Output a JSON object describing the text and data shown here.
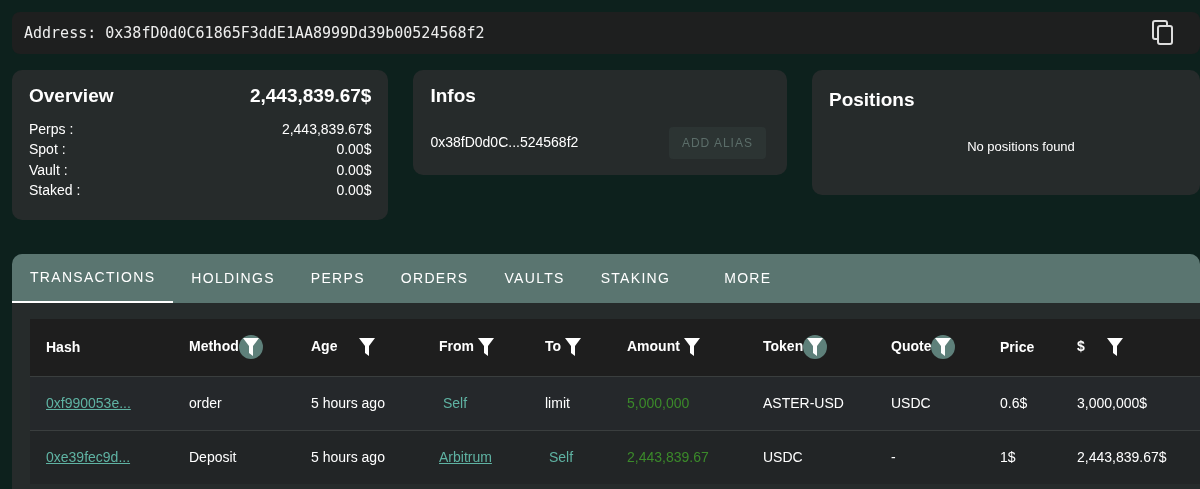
{
  "address_bar": {
    "label": "Address: 0x38fD0d0C61865F3ddE1AA8999Dd39b00524568f2"
  },
  "overview": {
    "title": "Overview",
    "total": "2,443,839.67$",
    "rows": [
      {
        "label": "Perps :",
        "value": "2,443,839.67$"
      },
      {
        "label": "Spot :",
        "value": "0.00$"
      },
      {
        "label": "Vault :",
        "value": "0.00$"
      },
      {
        "label": "Staked :",
        "value": "0.00$"
      }
    ]
  },
  "infos": {
    "title": "Infos",
    "address": "0x38fD0d0C...524568f2",
    "button": {
      "label": "ADD ALIAS",
      "disabled": true
    }
  },
  "positions": {
    "title": "Positions",
    "empty_text": "No positions found"
  },
  "tabs": [
    {
      "label": "TRANSACTIONS",
      "selected": true
    },
    {
      "label": "HOLDINGS",
      "selected": false
    },
    {
      "label": "PERPS",
      "selected": false
    },
    {
      "label": "ORDERS",
      "selected": false
    },
    {
      "label": "VAULTS",
      "selected": false
    },
    {
      "label": "STAKING",
      "selected": false
    },
    {
      "label": "MORE",
      "selected": false
    }
  ],
  "table": {
    "columns": [
      {
        "label": "Hash",
        "kind": "plain"
      },
      {
        "label": "Method",
        "kind": "filter",
        "filtered": true
      },
      {
        "label": "Age",
        "kind": "filter",
        "filtered": false
      },
      {
        "label": "From",
        "kind": "filter",
        "filtered": false
      },
      {
        "label": "To",
        "kind": "filter",
        "filtered": false
      },
      {
        "label": "Amount",
        "kind": "filter",
        "filtered": false
      },
      {
        "label": "Token",
        "kind": "filter",
        "filtered": true
      },
      {
        "label": "Quote",
        "kind": "filter",
        "filtered": true
      },
      {
        "label": "Price",
        "kind": "plain"
      },
      {
        "label": "$",
        "kind": "filter",
        "filtered": false
      }
    ],
    "rows": [
      {
        "cells": [
          {
            "kind": "link",
            "text": "0xf990053e..."
          },
          {
            "kind": "plain",
            "text": "order"
          },
          {
            "kind": "plain",
            "text": "5 hours ago"
          },
          {
            "kind": "tag",
            "text": "Self"
          },
          {
            "kind": "plain",
            "text": "limit"
          },
          {
            "kind": "amount",
            "text": "5,000,000"
          },
          {
            "kind": "plain",
            "text": "ASTER-USD"
          },
          {
            "kind": "plain",
            "text": "USDC"
          },
          {
            "kind": "plain",
            "text": "0.6$"
          },
          {
            "kind": "plain",
            "text": "3,000,000$"
          }
        ]
      },
      {
        "cells": [
          {
            "kind": "link",
            "text": "0xe39fec9d..."
          },
          {
            "kind": "plain",
            "text": "Deposit"
          },
          {
            "kind": "plain",
            "text": "5 hours ago"
          },
          {
            "kind": "link",
            "text": "Arbitrum"
          },
          {
            "kind": "tag",
            "text": "Self"
          },
          {
            "kind": "amount",
            "text": "2,443,839.67"
          },
          {
            "kind": "plain",
            "text": "USDC"
          },
          {
            "kind": "plain",
            "text": "-"
          },
          {
            "kind": "plain",
            "text": "1$"
          },
          {
            "kind": "plain",
            "text": "2,443,839.67$"
          }
        ]
      }
    ]
  }
}
